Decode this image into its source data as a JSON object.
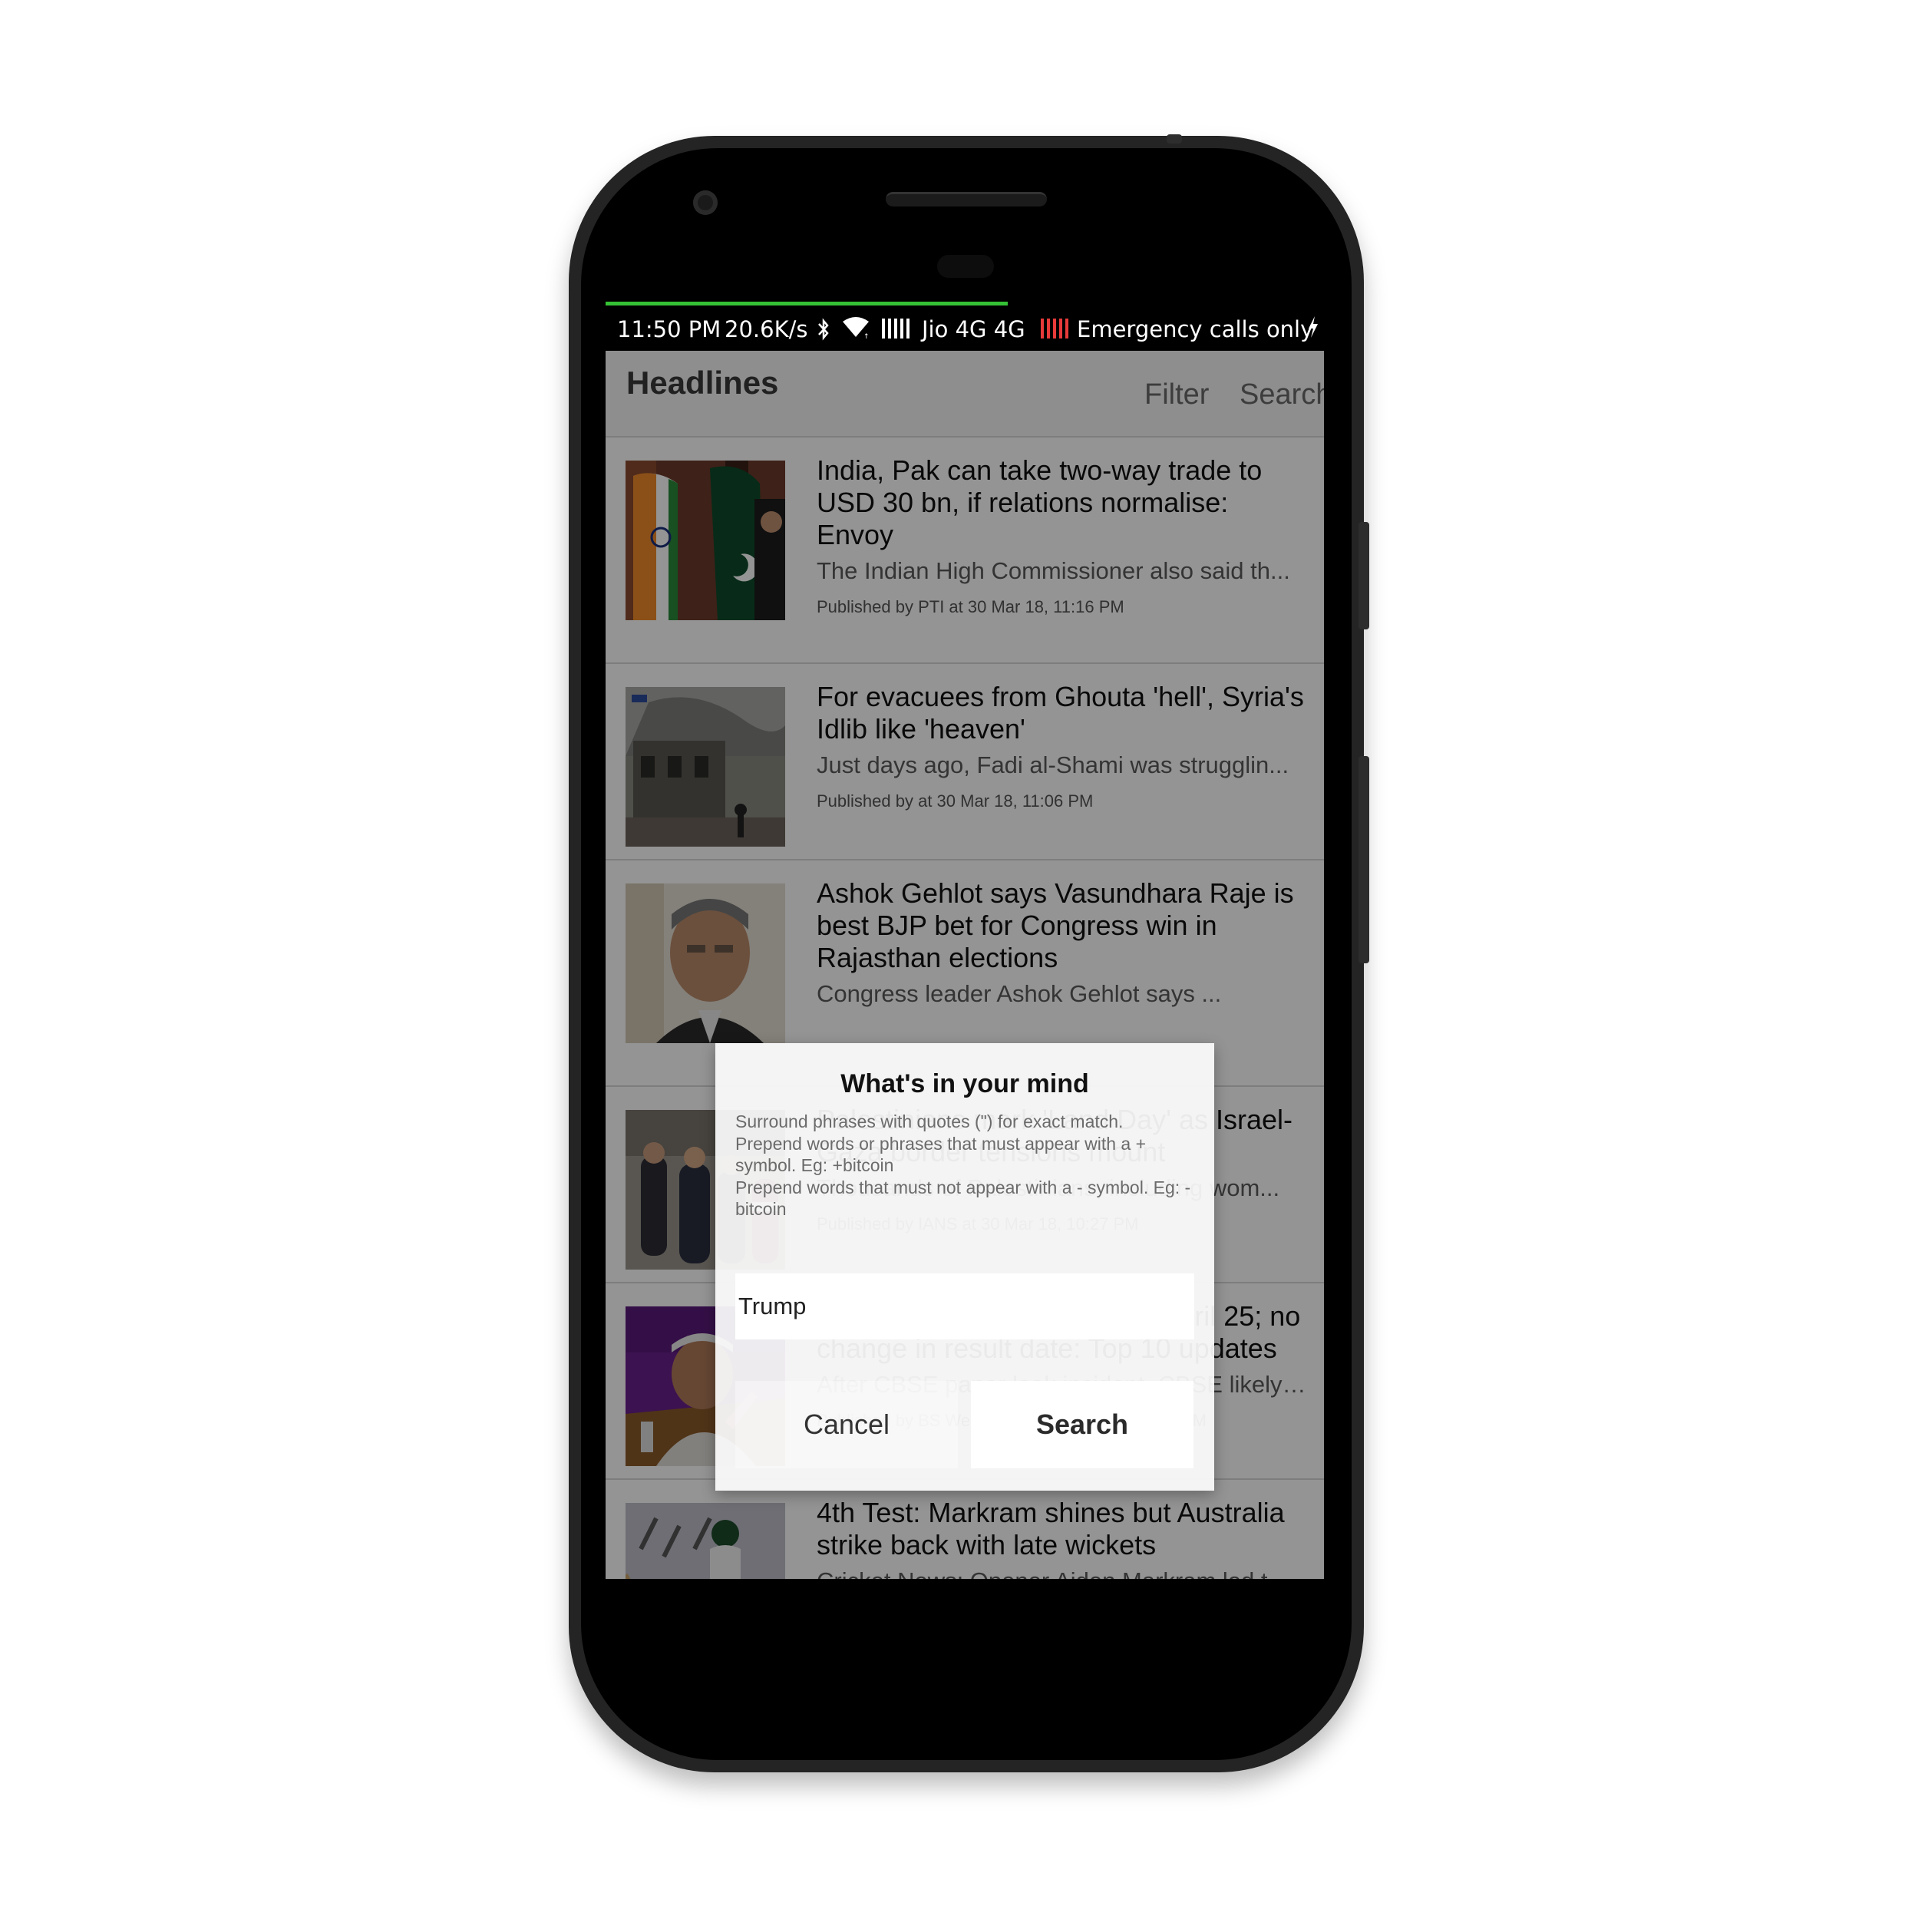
{
  "status_bar": {
    "time": "11:50 PM",
    "speed": "20.6K/s",
    "carrier": "Jio 4G 4G",
    "emergency": "Emergency calls only",
    "progress_fraction": 0.56,
    "progress_color": "#35c235",
    "icons": [
      "bluetooth-icon",
      "wifi-icon",
      "signal-icon",
      "signal-empty-icon",
      "charging-bolt-icon"
    ]
  },
  "app_bar": {
    "title": "Headlines",
    "filter_label": "Filter",
    "search_label": "Search"
  },
  "news": [
    {
      "headline": "India, Pak can take two-way trade to USD 30 bn, if relations normalise: Envoy",
      "snippet": "The Indian High Commissioner also said th...",
      "meta": "Published by PTI at 30 Mar 18, 11:16 PM"
    },
    {
      "headline": "For evacuees from Ghouta 'hell', Syria's Idlib like 'heaven'",
      "snippet": "Just days ago, Fadi al-Shami was strugglin...",
      "meta": "Published by at 30 Mar 18, 11:06 PM"
    },
    {
      "headline": "Ashok Gehlot says Vasundhara Raje is best BJP bet for Congress win in Rajasthan elections",
      "snippet": "Congress leader Ashok Gehlot says ...",
      "meta": ""
    },
    {
      "headline": "Palestinians mark 'Land Day' as Israel-Gaza border tensions mount",
      "snippet": "Thousands of Palestinians, including wom...",
      "meta": "Published by IANS at 30 Mar 18, 10:27 PM"
    },
    {
      "headline": "CBSE Class 12 re-exam on April 25; no change in result date: Top 10 updates",
      "snippet": "After CBSE paper leak incident, CBSE likely ...",
      "meta": "Published by BS Web Team at 30 Mar 18, 09:48 PM"
    },
    {
      "headline": "4th Test: Markram shines but Australia strike back with late wickets",
      "snippet": "Cricket News: Opener Aiden Markram led t...",
      "meta": ""
    }
  ],
  "dialog": {
    "title": "What's in your mind",
    "help": [
      "Surround phrases with quotes (\") for exact match.",
      "Prepend words or phrases that must appear with a + symbol. Eg: +bitcoin",
      "Prepend words that must not appear with a - symbol. Eg: -bitcoin"
    ],
    "input_value": "Trump",
    "cancel_label": "Cancel",
    "search_label": "Search"
  }
}
